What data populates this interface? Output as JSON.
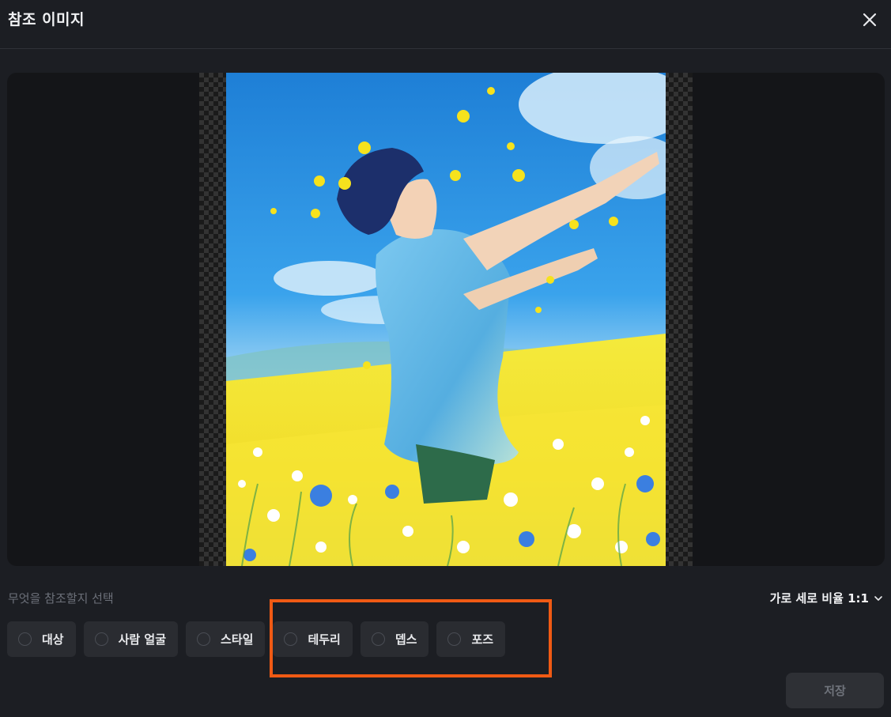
{
  "dialog": {
    "title": "참조 이미지"
  },
  "reference": {
    "label": "무엇을 참조할지 선택",
    "aspect_ratio": "가로 세로 비율 1:1",
    "options": [
      {
        "label": "대상",
        "selected": false
      },
      {
        "label": "사람 얼굴",
        "selected": false
      },
      {
        "label": "스타일",
        "selected": false
      },
      {
        "label": "테두리",
        "selected": false
      },
      {
        "label": "뎁스",
        "selected": false
      },
      {
        "label": "포즈",
        "selected": false
      }
    ]
  },
  "footer": {
    "save_label": "저장",
    "save_enabled": false
  },
  "colors": {
    "background": "#1c1e23",
    "highlight": "#f05a14",
    "option_bg": "#2a2c31"
  }
}
